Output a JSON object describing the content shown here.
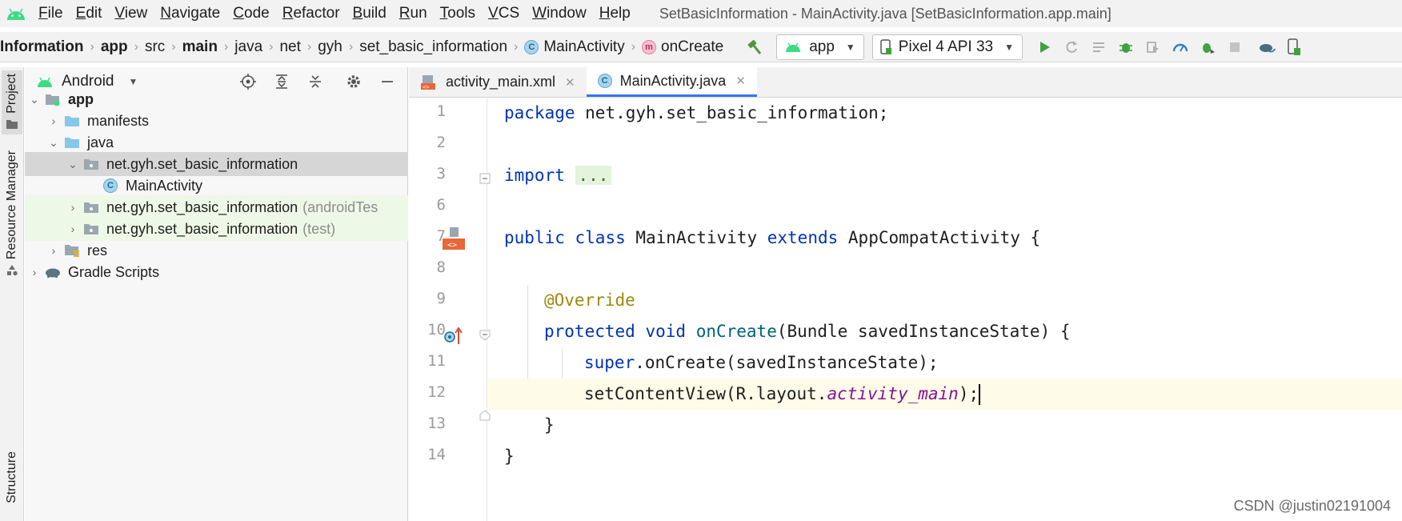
{
  "menubar": {
    "items": [
      "File",
      "Edit",
      "View",
      "Navigate",
      "Code",
      "Refactor",
      "Build",
      "Run",
      "Tools",
      "VCS",
      "Window",
      "Help"
    ],
    "window_title": "SetBasicInformation - MainActivity.java [SetBasicInformation.app.main]"
  },
  "navbar": {
    "breadcrumbs": [
      "Information",
      "app",
      "src",
      "main",
      "java",
      "net",
      "gyh",
      "set_basic_information",
      "MainActivity",
      "onCreate"
    ],
    "run_config": "app",
    "device": "Pixel 4 API 33"
  },
  "left_stripe": {
    "project_tab": "Project",
    "resource_manager_tab": "Resource Manager",
    "structure_tab": "Structure"
  },
  "project_panel": {
    "view_mode": "Android",
    "tree": [
      {
        "label": "app",
        "suffix": ""
      },
      {
        "label": "manifests",
        "suffix": ""
      },
      {
        "label": "java",
        "suffix": ""
      },
      {
        "label": "net.gyh.set_basic_information",
        "suffix": ""
      },
      {
        "label": "MainActivity",
        "suffix": ""
      },
      {
        "label": "net.gyh.set_basic_information",
        "suffix": "(androidTes"
      },
      {
        "label": "net.gyh.set_basic_information",
        "suffix": "(test)"
      },
      {
        "label": "res",
        "suffix": ""
      },
      {
        "label": "Gradle Scripts",
        "suffix": ""
      }
    ]
  },
  "editor": {
    "tabs": [
      "activity_main.xml",
      "MainActivity.java"
    ],
    "active_tab": "MainActivity.java",
    "line_numbers": [
      "1",
      "2",
      "3",
      "6",
      "7",
      "8",
      "9",
      "10",
      "11",
      "12",
      "13",
      "14"
    ],
    "code": {
      "l1_kw": "package",
      "l1_rest": " net.gyh.set_basic_information;",
      "l3_kw": "import",
      "l3_fold": "...",
      "l7_kw1": "public",
      "l7_kw2": "class",
      "l7_name": " MainActivity ",
      "l7_kw3": "extends",
      "l7_rest": " AppCompatActivity {",
      "l9_ann": "@Override",
      "l10_kw1": "protected",
      "l10_kw2": "void",
      "l10_mth": "onCreate",
      "l10_rest": "(Bundle savedInstanceState) {",
      "l11_kw": "super",
      "l11_rest": ".onCreate(savedInstanceState);",
      "l12_pre": "setContentView(R.layout.",
      "l12_field": "activity_main",
      "l12_post": ");",
      "l13": "}",
      "l14": "}"
    }
  },
  "watermark": "CSDN @justin02191004",
  "colors": {
    "keyword": "#0033b3",
    "annotation": "#9e880d",
    "method": "#00627a",
    "field": "#871094",
    "android_green": "#3ddc84",
    "run_green": "#3ea33e"
  }
}
